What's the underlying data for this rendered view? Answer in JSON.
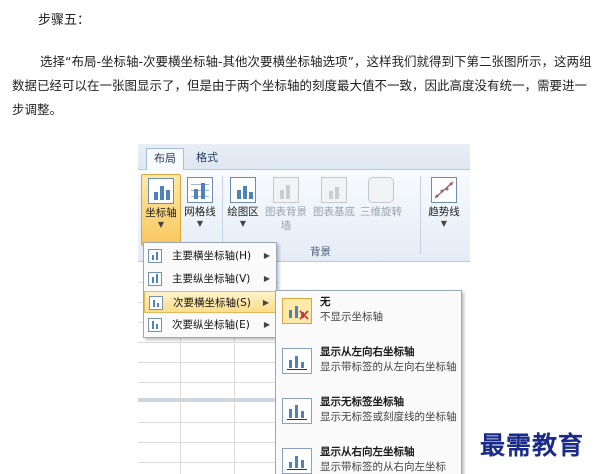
{
  "article": {
    "step_title": "步骤五：",
    "paragraph": "选择“布局-坐标轴-次要横坐标轴-其他次要横坐标轴选项”，这样我们就得到下第二张图所示，这两组数据已经可以在一张图显示了，但是由于两个坐标轴的刻度最大值不一致，因此高度没有统一，需要进一步调整。"
  },
  "ribbon": {
    "tabs": [
      {
        "label": "布局",
        "active": true
      },
      {
        "label": "格式",
        "active": false
      }
    ],
    "buttons": [
      {
        "label": "坐标轴",
        "state": "selected",
        "icon": "axis-chart-icon"
      },
      {
        "label": "网格线",
        "state": "enabled",
        "icon": "gridlines-chart-icon"
      },
      {
        "label": "绘图区",
        "state": "enabled",
        "icon": "plot-area-icon"
      },
      {
        "label": "图表背景墙",
        "state": "disabled",
        "icon": "chart-wall-icon"
      },
      {
        "label": "图表基底",
        "state": "disabled",
        "icon": "chart-floor-icon"
      },
      {
        "label": "三维旋转",
        "state": "disabled",
        "icon": "3d-rotation-icon"
      },
      {
        "label": "趋势线",
        "state": "enabled",
        "icon": "trendline-icon"
      }
    ],
    "group_label": "背景"
  },
  "axis_menu": {
    "items": [
      {
        "label": "主要横坐标轴(H)",
        "highlighted": false
      },
      {
        "label": "主要纵坐标轴(V)",
        "highlighted": false
      },
      {
        "label": "次要横坐标轴(S)",
        "highlighted": true
      },
      {
        "label": "次要纵坐标轴(E)",
        "highlighted": false
      }
    ]
  },
  "secondary_axis_menu": {
    "items": [
      {
        "title": "无",
        "desc": "不显示坐标轴",
        "icon": "no-axis-icon",
        "selected": true
      },
      {
        "title": "显示从左向右坐标轴",
        "desc": "显示带标签的从左向右坐标轴",
        "icon": "left-to-right-axis-icon",
        "selected": false
      },
      {
        "title": "显示无标签坐标轴",
        "desc": "显示无标签或刻度线的坐标轴",
        "icon": "no-label-axis-icon",
        "selected": false
      },
      {
        "title": "显示从右向左坐标轴",
        "desc": "显示带标签的从右向左坐标",
        "icon": "right-to-left-axis-icon",
        "selected": false
      }
    ]
  },
  "watermark": "最需教育",
  "colors": {
    "accent_bar": "#4f81bd",
    "hover_gold": "#fbdd8a",
    "watermark": "#1a2a8a"
  }
}
